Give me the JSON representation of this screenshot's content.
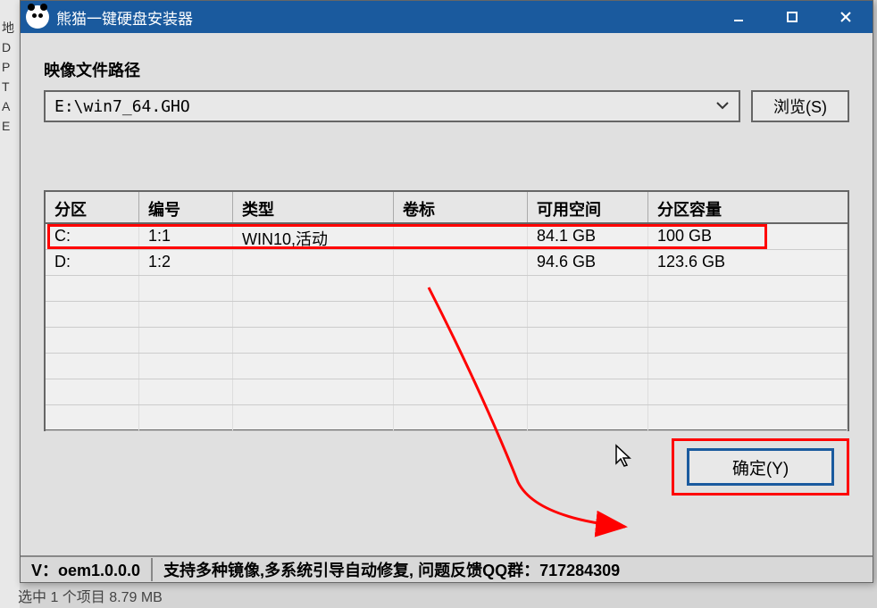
{
  "titlebar": {
    "title": "熊猫一键硬盘安装器"
  },
  "content": {
    "image_path_label": "映像文件路径",
    "image_path_value": "E:\\win7_64.GHO",
    "browse_button": "浏览(S)"
  },
  "table": {
    "headers": {
      "partition": "分区",
      "number": "编号",
      "type": "类型",
      "volume": "卷标",
      "free": "可用空间",
      "size": "分区容量"
    },
    "rows": [
      {
        "partition": "C:",
        "number": "1:1",
        "type": "WIN10,活动",
        "volume": "",
        "free": "84.1 GB",
        "size": "100 GB"
      },
      {
        "partition": "D:",
        "number": "1:2",
        "type": "",
        "volume": "",
        "free": "94.6 GB",
        "size": "123.6 GB"
      }
    ]
  },
  "buttons": {
    "ok": "确定(Y)"
  },
  "statusbar": {
    "version": "V：oem1.0.0.0",
    "support": "支持多种镜像,多系统引导自动修复, 问题反馈QQ群：717284309"
  },
  "background": {
    "bottom_text": "选中 1 个项目  8.79 MB",
    "side_chars": [
      "地",
      "D",
      "P",
      "T",
      "A",
      "E"
    ]
  }
}
